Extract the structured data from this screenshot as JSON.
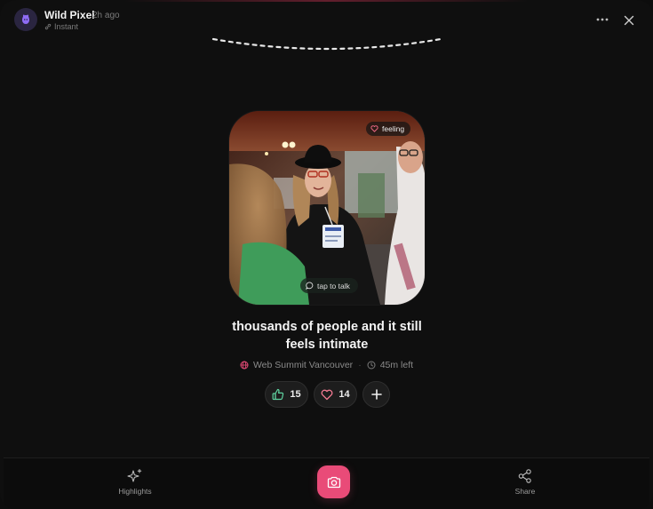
{
  "post": {
    "author": "Wild Pixel",
    "time": "2h ago",
    "mode": "Instant",
    "mood_chip": "feeling",
    "talk_chip": "tap to talk",
    "caption_line1": "thousands of people and it still",
    "caption_line2": "feels intimate",
    "location": "Web Summit Vancouver",
    "time_left": "45m left"
  },
  "reactions": {
    "likes": "15",
    "hearts": "14"
  },
  "bottom_nav": {
    "highlights_label": "Highlights",
    "share_label": "Share"
  },
  "colors": {
    "accent": "#e94b78",
    "like_icon": "#5fd3a0",
    "heart_icon": "#f27a92",
    "avatar_icon": "#8f6cf5"
  },
  "icons": [
    "avatar-pixel-icon",
    "link-icon",
    "more-icon",
    "close-icon",
    "heart-outline-icon",
    "chat-bubble-icon",
    "globe-icon",
    "clock-icon",
    "thumbs-up-icon",
    "heart-icon",
    "plus-icon",
    "sparkles-icon",
    "camera-icon",
    "share-icon"
  ]
}
